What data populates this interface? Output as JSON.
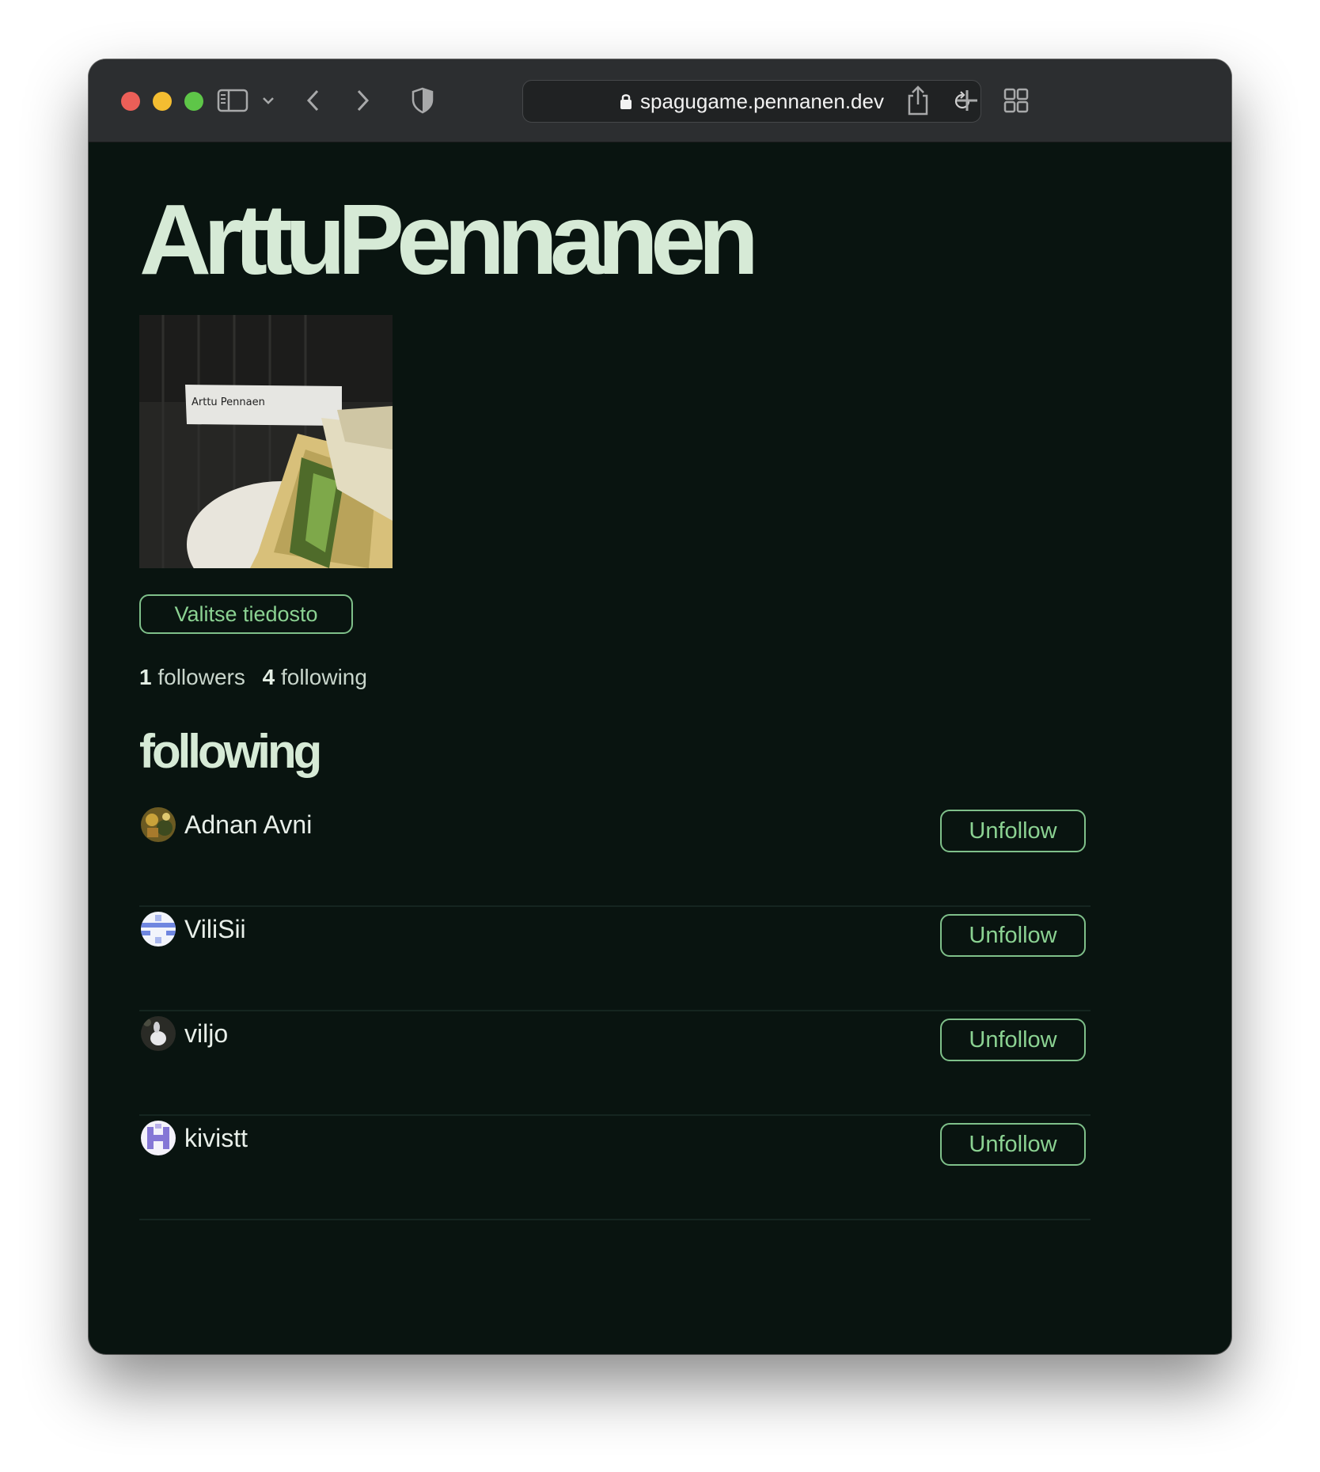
{
  "browser": {
    "url": "spagugame.pennanen.dev",
    "icons": [
      "sidebar-icon",
      "chevron-down-icon",
      "back-icon",
      "forward-icon",
      "shield-icon",
      "lock-icon",
      "reload-icon",
      "share-icon",
      "new-tab-icon",
      "tab-overview-icon"
    ]
  },
  "profile": {
    "name": "ArttuPennanen",
    "photo_label": "Arttu Pennaen",
    "file_button": "Valitse tiedosto",
    "followers_count": "1",
    "followers_label": "followers",
    "following_count": "4",
    "following_label": "following"
  },
  "following": {
    "heading": "following",
    "users": [
      {
        "name": "Adnan Avni",
        "action": "Unfollow"
      },
      {
        "name": "ViliSii",
        "action": "Unfollow"
      },
      {
        "name": "viljo",
        "action": "Unfollow"
      },
      {
        "name": "kivistt",
        "action": "Unfollow"
      }
    ]
  },
  "colors": {
    "background": "#091410",
    "heading": "#d6ead6",
    "accent": "#8bd292",
    "toolbar": "#2c2e30"
  }
}
